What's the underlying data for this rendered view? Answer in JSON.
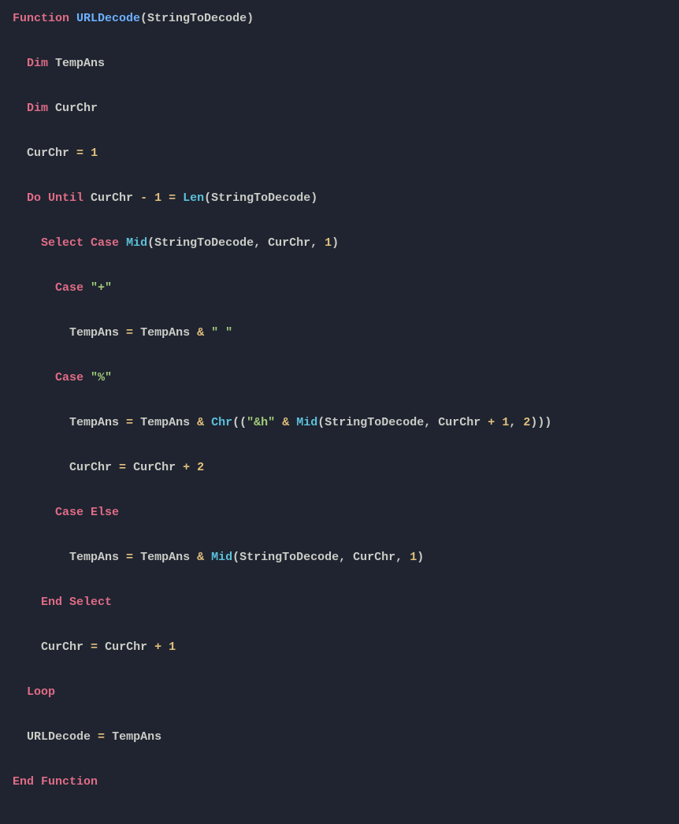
{
  "code": {
    "l1": {
      "kw1": "Function",
      "fn": "URLDecode",
      "p": "(StringToDecode)"
    },
    "l2": {
      "kw": "Dim",
      "id": "TempAns"
    },
    "l3": {
      "kw": "Dim",
      "id": "CurChr"
    },
    "l4": {
      "id": "CurChr",
      "op": "=",
      "num": "1"
    },
    "l5": {
      "kw1": "Do Until",
      "id1": "CurChr",
      "op1": "-",
      "n1": "1",
      "op2": "=",
      "fn": "Len",
      "p": "(StringToDecode)"
    },
    "l6": {
      "kw1": "Select",
      "kw2": "Case",
      "fn": "Mid",
      "p1": "(StringToDecode, CurChr,",
      "n": "1",
      "p2": ")"
    },
    "l7": {
      "kw": "Case",
      "str": "\"+\""
    },
    "l8": {
      "id1": "TempAns",
      "op1": "=",
      "id2": "TempAns",
      "op2": "&",
      "str": "\" \""
    },
    "l9": {
      "kw": "Case",
      "str": "\"%\""
    },
    "l10": {
      "id1": "TempAns",
      "op1": "=",
      "id2": "TempAns",
      "op2": "&",
      "fn1": "Chr",
      "p1": "((",
      "str": "\"&h\"",
      "op3": "&",
      "fn2": "Mid",
      "p2": "(StringToDecode, CurChr",
      "op4": "+",
      "n1": "1",
      "c": ",",
      "n2": "2",
      "p3": ")))"
    },
    "l11": {
      "id1": "CurChr",
      "op1": "=",
      "id2": "CurChr",
      "op2": "+",
      "n": "2"
    },
    "l12": {
      "kw": "Case Else"
    },
    "l13": {
      "id1": "TempAns",
      "op1": "=",
      "id2": "TempAns",
      "op2": "&",
      "fn": "Mid",
      "p1": "(StringToDecode, CurChr,",
      "n": "1",
      "p2": ")"
    },
    "l14": {
      "kw": "End Select"
    },
    "l15": {
      "id1": "CurChr",
      "op1": "=",
      "id2": "CurChr",
      "op2": "+",
      "n": "1"
    },
    "l16": {
      "kw": "Loop"
    },
    "l17": {
      "id1": "URLDecode",
      "op": "=",
      "id2": "TempAns"
    },
    "l18": {
      "kw": "End Function"
    }
  }
}
